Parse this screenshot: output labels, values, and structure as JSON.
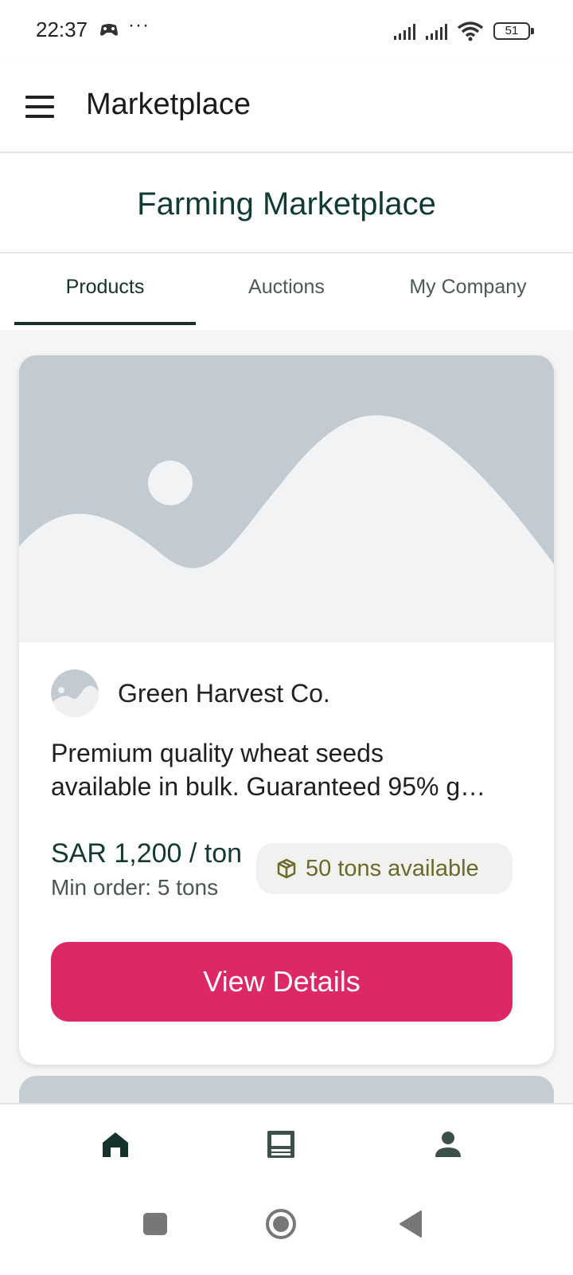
{
  "status_bar": {
    "time": "22:37",
    "more": "···",
    "battery": "51"
  },
  "app_bar": {
    "title": "Marketplace",
    "menu_icon": "hamburger-menu-icon"
  },
  "page": {
    "title": "Farming Marketplace"
  },
  "tabs": [
    {
      "label": "Products",
      "active": true
    },
    {
      "label": "Auctions",
      "active": false
    },
    {
      "label": "My Company",
      "active": false
    }
  ],
  "product_card": {
    "image_icon": "image-placeholder-icon",
    "seller": "Green Harvest Co.",
    "description_line1": "Premium quality wheat seeds",
    "description_line2": "available in bulk. Guaranteed 95% g…",
    "price": "SAR 1,200 / ton",
    "min_order": "Min order: 5 tons",
    "stock": "50 tons available",
    "stock_icon": "box-icon",
    "button_label": "View Details"
  },
  "bottom_nav": [
    {
      "icon": "home-icon",
      "active": true
    },
    {
      "icon": "catalog-icon",
      "active": false
    },
    {
      "icon": "person-icon",
      "active": false
    }
  ],
  "colors": {
    "primary_dark": "#16322d",
    "title_green": "#103b34",
    "button_pink": "#dd2867",
    "stock_text": "#6b6a2a",
    "placeholder_gray": "#c2cbd2",
    "background": "#f5f6f4"
  }
}
